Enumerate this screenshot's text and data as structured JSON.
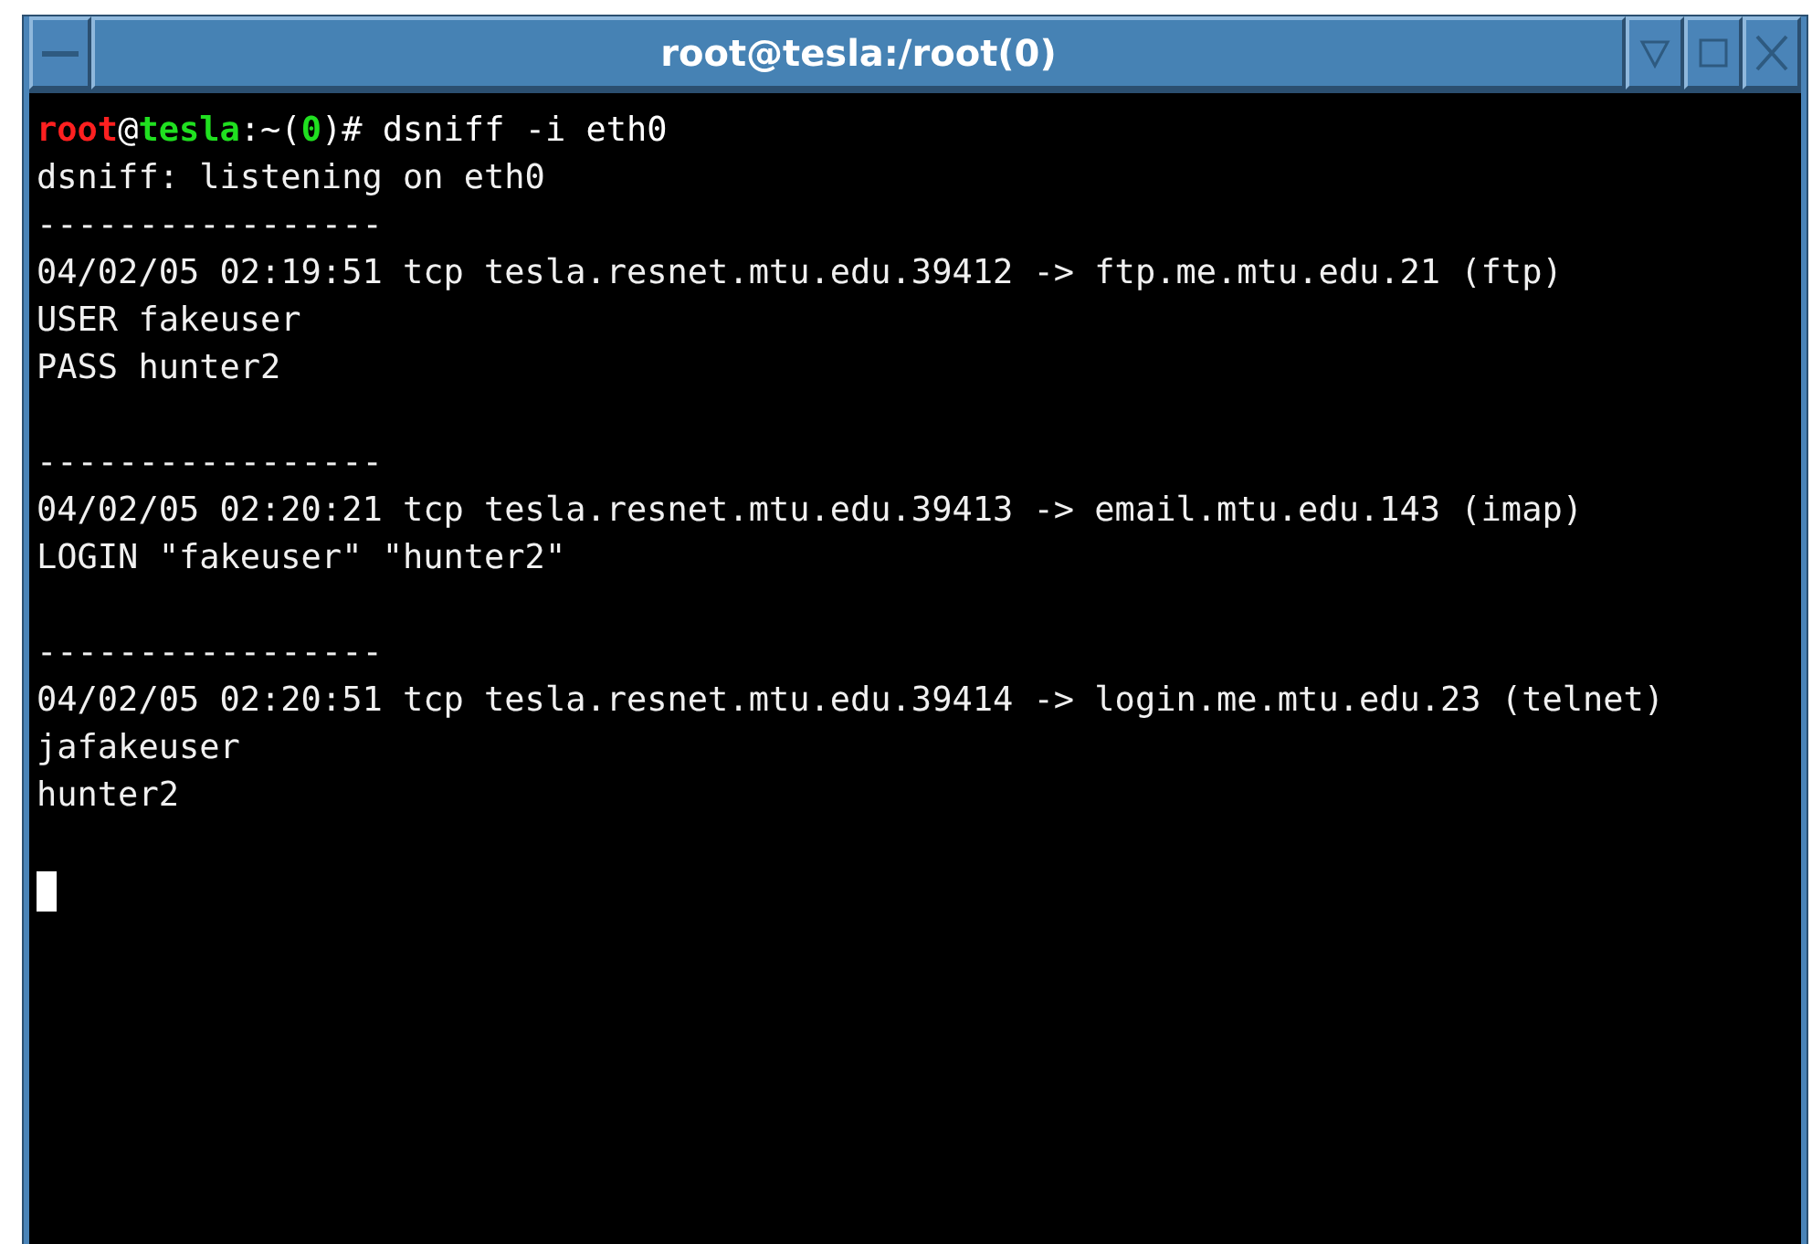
{
  "window": {
    "title": "root@tesla:/root(0)"
  },
  "terminal": {
    "lines": [
      {
        "kind": "prompt",
        "segments": [
          {
            "text": "root",
            "color": "#ff2020"
          },
          {
            "text": "@",
            "color": "#ffffff"
          },
          {
            "text": "tesla",
            "color": "#20e020"
          },
          {
            "text": ":~(",
            "color": "#ffffff"
          },
          {
            "text": "0",
            "color": "#20e020"
          },
          {
            "text": ")# dsniff -i eth0",
            "color": "#ffffff"
          }
        ]
      },
      {
        "kind": "output",
        "text": "dsniff: listening on eth0"
      },
      {
        "kind": "output",
        "text": "-----------------"
      },
      {
        "kind": "output",
        "text": "04/02/05 02:19:51 tcp tesla.resnet.mtu.edu.39412 -> ftp.me.mtu.edu.21 (ftp)"
      },
      {
        "kind": "output",
        "text": "USER fakeuser"
      },
      {
        "kind": "output",
        "text": "PASS hunter2"
      },
      {
        "kind": "blank"
      },
      {
        "kind": "output",
        "text": "-----------------"
      },
      {
        "kind": "output",
        "text": "04/02/05 02:20:21 tcp tesla.resnet.mtu.edu.39413 -> email.mtu.edu.143 (imap)"
      },
      {
        "kind": "output",
        "text": "LOGIN \"fakeuser\" \"hunter2\""
      },
      {
        "kind": "blank"
      },
      {
        "kind": "output",
        "text": "-----------------"
      },
      {
        "kind": "output",
        "text": "04/02/05 02:20:51 tcp tesla.resnet.mtu.edu.39414 -> login.me.mtu.edu.23 (telnet)"
      },
      {
        "kind": "output",
        "text": "jafakeuser"
      },
      {
        "kind": "output",
        "text": "hunter2"
      },
      {
        "kind": "blank"
      },
      {
        "kind": "cursor"
      }
    ]
  }
}
